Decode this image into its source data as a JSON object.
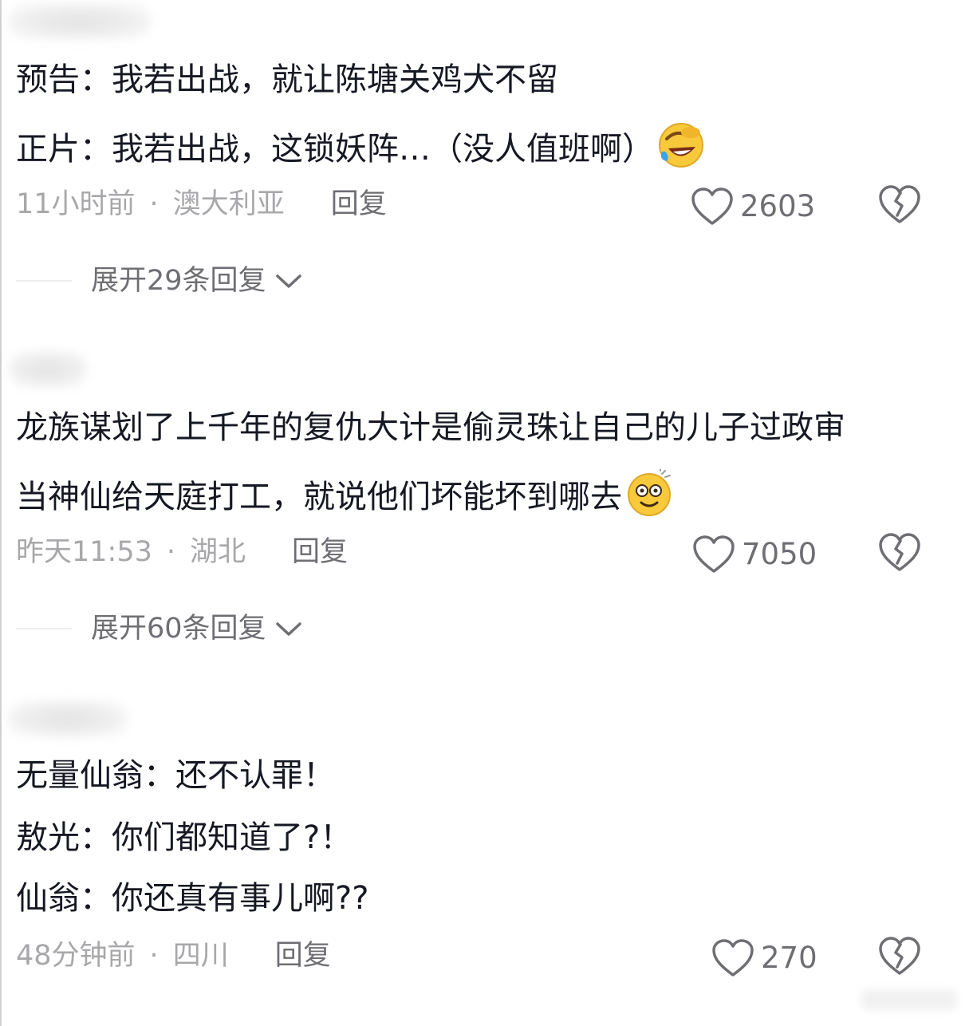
{
  "comments": [
    {
      "lines": [
        "预告：我若出战，就让陈塘关鸡犬不留",
        "正片：我若出战，这锁妖阵…（没人值班啊）"
      ],
      "emoji": "rolling-on-floor-laughing-emoji",
      "time": "11小时前",
      "location": "澳大利亚",
      "reply": "回复",
      "likes": "2603",
      "expand": "展开29条回复"
    },
    {
      "lines": [
        "龙族谋划了上千年的复仇大计是偷灵珠让自己的儿子过政审",
        "当神仙给天庭打工，就说他们坏能坏到哪去"
      ],
      "emoji": "dizzy-smiling-emoji",
      "time": "昨天11:53",
      "location": "湖北",
      "reply": "回复",
      "likes": "7050",
      "expand": "展开60条回复"
    },
    {
      "lines": [
        "无量仙翁：还不认罪！",
        "敖光：你们都知道了?！",
        "仙翁：你还真有事儿啊??"
      ],
      "time": "48分钟前",
      "location": "四川",
      "reply": "回复",
      "likes": "270"
    }
  ],
  "separator": "·",
  "colors": {
    "text": "#161823",
    "meta": "#a8a8ab",
    "secondary": "#6e6e73"
  }
}
